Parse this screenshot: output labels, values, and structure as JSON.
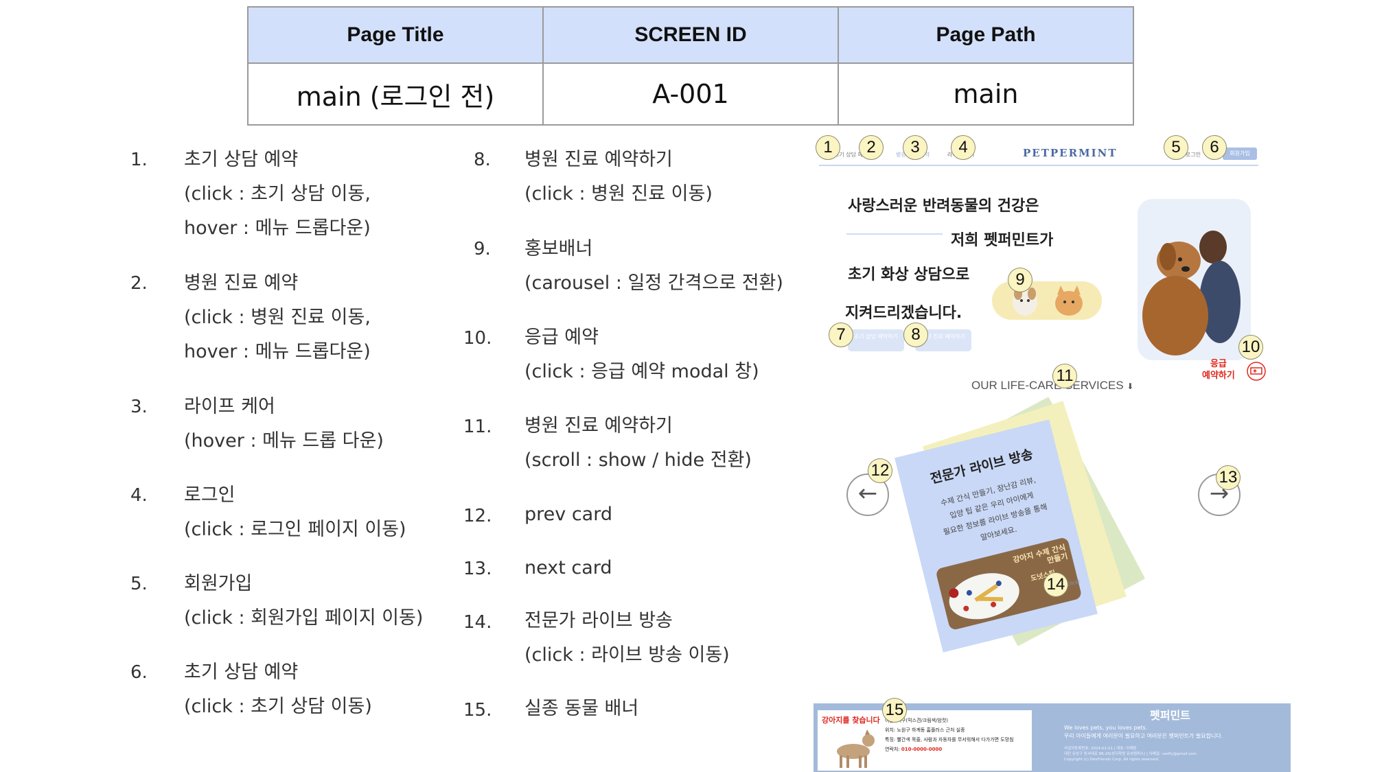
{
  "header": {
    "columns": [
      "Page Title",
      "SCREEN ID",
      "Page Path"
    ],
    "values": [
      "main (로그인 전)",
      "A-001",
      "main"
    ]
  },
  "items": [
    {
      "num": "1.",
      "lines": [
        "초기 상담 예약",
        "(click : 초기 상담 이동,",
        "hover : 메뉴 드롭다운)"
      ]
    },
    {
      "num": "2.",
      "lines": [
        "병원 진료 예약",
        "(click : 병원 진료 이동,",
        "hover : 메뉴 드롭다운)"
      ]
    },
    {
      "num": "3.",
      "lines": [
        "라이프 케어",
        "(hover : 메뉴 드롭 다운)"
      ]
    },
    {
      "num": "4.",
      "lines": [
        "로그인",
        "(click : 로그인 페이지 이동)"
      ]
    },
    {
      "num": "5.",
      "lines": [
        "회원가입",
        "(click : 회원가입 페이지 이동)"
      ]
    },
    {
      "num": "6.",
      "lines": [
        "초기 상담 예약",
        "(click : 초기 상담 이동)"
      ]
    },
    {
      "num": "8.",
      "lines": [
        "병원 진료 예약하기",
        "(click : 병원 진료 이동)"
      ]
    },
    {
      "num": "9.",
      "lines": [
        "홍보배너",
        "(carousel : 일정 간격으로 전환)"
      ]
    },
    {
      "num": "10.",
      "lines": [
        "응급 예약",
        "(click : 응급 예약 modal 창)"
      ]
    },
    {
      "num": "11.",
      "lines": [
        "병원 진료 예약하기",
        "(scroll : show / hide 전환)"
      ]
    },
    {
      "num": "12.",
      "lines": [
        "prev card"
      ]
    },
    {
      "num": "13.",
      "lines": [
        "next card"
      ]
    },
    {
      "num": "14.",
      "lines": [
        "전문가 라이브 방송",
        "(click : 라이브 방송 이동)"
      ]
    },
    {
      "num": "15.",
      "lines": [
        "실종 동물 배너"
      ]
    }
  ],
  "mockup": {
    "nav": {
      "item1": "초기 상담 예약",
      "item2": "병원 진료 예약",
      "item3": "라이프 케어",
      "logo": "PETPERMINT",
      "login": "로그인",
      "signup": "회원가입"
    },
    "badges": [
      "1",
      "2",
      "3",
      "4",
      "5",
      "6",
      "7",
      "8",
      "9",
      "10",
      "11",
      "12",
      "13",
      "14",
      "15"
    ],
    "hero": {
      "line1": "사랑스러운 반려동물의 건강은",
      "line2": "저희 펫퍼민트가",
      "line3": "초기 화상 상담으로",
      "line4": "지켜드리겠습니다.",
      "btn1": "초기 상담 예약하기",
      "btn2": "병원 진료 예약하기"
    },
    "emergency": {
      "line1": "응급",
      "line2": "예약하기"
    },
    "services": "OUR LIFE-CARE SERVICES",
    "card": {
      "title": "전문가 라이브 방송",
      "body_lines": [
        "수제 간식 만들기, 장난감 리뷰,",
        "입양 팁 같은 우리 아이에게",
        "필요한 정보를 라이브 방송을 통해",
        "알아보세요."
      ],
      "img_text": "강아지 수제 간식 만들기",
      "img_sub": "도넛스틱",
      "click": "click!"
    },
    "lost": {
      "title": "강아지를 찾습니다",
      "info": [
        "이름: 백구(믹스견/크림색/암컷)",
        "위치: 노원구 하계동 홈플러스 근처 실종",
        "특징: 빨간색 목줄, 사람과 자동차를 무서워해서 다가가면 도망침",
        "연락처: "
      ],
      "phone": "010-0000-0000"
    },
    "footer": {
      "brand": "펫퍼민트",
      "tagline1": "We loves pets, you loves pets.",
      "tagline2": "우리 아이들에게 여러분이 필요하고 여러분은 펫퍼민트가 필요합니다.",
      "small1": "사업자등록번호: 2024-01-01 | 대표: 이채원",
      "small2": "대전 유성구 동서대로 86-20(성지학원 유성캠퍼스) | 이메일: cexfly@gmail.com",
      "small3": "Copyright (c) DevFriends Corp. All rights reserved."
    },
    "colors": {
      "accent": "#d3e0fb",
      "badge": "#fbf4c3",
      "emergency": "#e0251c",
      "footer": "#a3badb"
    }
  }
}
